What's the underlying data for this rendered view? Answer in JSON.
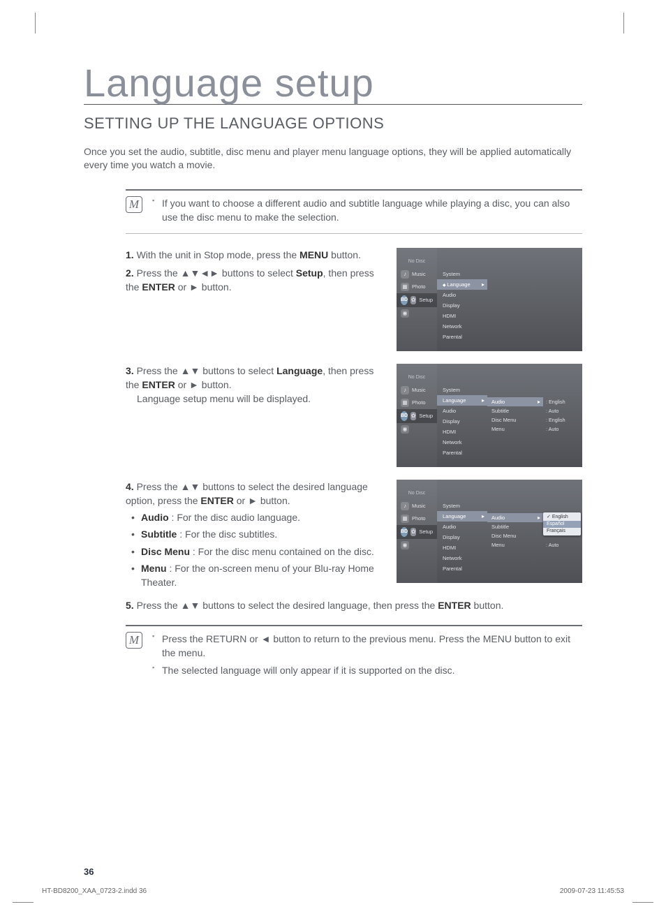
{
  "chapter_title": "Language setup",
  "section_title": "SETTING UP THE LANGUAGE OPTIONS",
  "intro": "Once you set the audio, subtitle, disc menu and player menu language options, they will be applied automatically every time you watch a movie.",
  "note_top": "If you want to choose a different audio and subtitle language while playing a disc, you can also use the disc menu to make the selection.",
  "steps": {
    "s1_pre": "1.",
    "s1_a": " With the unit in Stop mode, press the ",
    "s1_b": "MENU",
    "s1_c": " button.",
    "s2_pre": "2.",
    "s2_a": " Press the ▲▼◄► buttons to select ",
    "s2_b": "Setup",
    "s2_c": ", then press the ",
    "s2_d": "ENTER",
    "s2_e": " or ► button.",
    "s3_pre": "3.",
    "s3_a": " Press the ▲▼ buttons to select ",
    "s3_b": "Language",
    "s3_c": ", then press the ",
    "s3_d": "ENTER",
    "s3_e": " or ► button.",
    "s3_f": "Language setup menu will be displayed.",
    "s4_pre": "4.",
    "s4_a": " Press the ▲▼ buttons to select the desired language option, press the ",
    "s4_b": "ENTER",
    "s4_c": " or ► button.",
    "s4_bullets": [
      {
        "label": "Audio",
        "desc": " : For the disc audio language."
      },
      {
        "label": "Subtitle",
        "desc": " : For the disc subtitles."
      },
      {
        "label": "Disc Menu",
        "desc": " : For the disc menu contained on the disc."
      },
      {
        "label": "Menu",
        "desc": " : For the on-screen menu of your Blu-ray Home Theater."
      }
    ],
    "s5_pre": "5.",
    "s5_a": " Press the ▲▼ buttons to select the desired language, then press the ",
    "s5_b": "ENTER",
    "s5_c": " button."
  },
  "note_bottom": [
    "Press the RETURN or ◄ button to return to the previous menu. Press the MENU button to exit the menu.",
    "The selected language will only appear if it is supported on the disc."
  ],
  "osd": {
    "sidebar": {
      "no_disc": "No Disc",
      "music": "Music",
      "photo": "Photo",
      "setup": "Setup",
      "bd_label": "♫"
    },
    "menu1": {
      "items": [
        "System",
        "Language",
        "Audio",
        "Display",
        "HDMI",
        "Network",
        "Parental"
      ],
      "highlight": "Language"
    },
    "menu2_col3": [
      "Audio",
      "Subtitle",
      "Disc Menu",
      "Menu"
    ],
    "menu2_col4": [
      "English",
      "Auto",
      "English",
      "Auto"
    ],
    "menu3_dropdown": [
      "English",
      "Español",
      "Français"
    ],
    "menu3_col4_below": [
      "",
      "Auto",
      "",
      "Auto"
    ]
  },
  "page_number": "36",
  "footer_left": "HT-BD8200_XAA_0723-2.indd   36",
  "footer_right": "2009-07-23   11:45:53"
}
